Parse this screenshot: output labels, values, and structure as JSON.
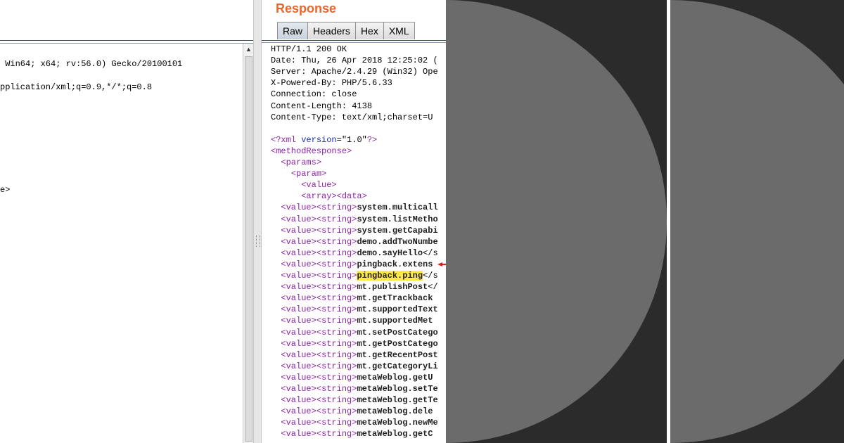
{
  "request": {
    "lines": [
      " Win64; x64; rv:56.0) Gecko/20100101",
      "",
      "pplication/xml;q=0.9,*/*;q=0.8",
      "",
      "",
      "",
      "",
      "",
      "",
      "",
      "",
      "e>"
    ]
  },
  "response": {
    "title": "Response",
    "tabs": [
      {
        "label": "Raw",
        "active": true
      },
      {
        "label": "Headers",
        "active": false
      },
      {
        "label": "Hex",
        "active": false
      },
      {
        "label": "XML",
        "active": false
      }
    ],
    "headers": [
      "HTTP/1.1 200 OK",
      "Date: Thu, 26 Apr 2018 12:25:02 (",
      "Server: Apache/2.4.29 (Win32) Ope",
      "X-Powered-By: PHP/5.6.33",
      "Connection: close",
      "Content-Length: 4138",
      "Content-Type: text/xml;charset=U"
    ],
    "xml_decl": {
      "open": "<?xml ",
      "attr": "version",
      "eq": "=\"1.0\"",
      "close": "?>"
    },
    "structure": [
      {
        "indent": "",
        "text": "<methodResponse>"
      },
      {
        "indent": "  ",
        "text": "<params>"
      },
      {
        "indent": "    ",
        "text": "<param>"
      },
      {
        "indent": "      ",
        "text": "<value>"
      },
      {
        "indent": "      ",
        "text": "<array><data>"
      }
    ],
    "value_open": "<value><string>",
    "methods": [
      {
        "name": "system.multicall",
        "tail": "",
        "highlight": false
      },
      {
        "name": "system.listMetho",
        "tail": "",
        "highlight": false
      },
      {
        "name": "system.getCapabi",
        "tail": "",
        "highlight": false
      },
      {
        "name": "demo.addTwoNumbe",
        "tail": "",
        "highlight": false
      },
      {
        "name": "demo.sayHello",
        "tail": "</s",
        "highlight": false
      },
      {
        "name": "pingback.extens",
        "tail": "",
        "highlight": false
      },
      {
        "name": "pingback.ping",
        "tail": "</s",
        "highlight": true
      },
      {
        "name": "mt.publishPost",
        "tail": "</",
        "highlight": false
      },
      {
        "name": "mt.getTrackback",
        "tail": "",
        "highlight": false
      },
      {
        "name": "mt.supportedText",
        "tail": "",
        "highlight": false
      },
      {
        "name": "mt.supportedMet",
        "tail": "",
        "highlight": false
      },
      {
        "name": "mt.setPostCatego",
        "tail": "",
        "highlight": false
      },
      {
        "name": "mt.getPostCatego",
        "tail": "",
        "highlight": false
      },
      {
        "name": "mt.getRecentPost",
        "tail": "",
        "highlight": false
      },
      {
        "name": "mt.getCategoryLi",
        "tail": "",
        "highlight": false
      },
      {
        "name": "metaWeblog.getU",
        "tail": "",
        "highlight": false
      },
      {
        "name": "metaWeblog.setTe",
        "tail": "",
        "highlight": false
      },
      {
        "name": "metaWeblog.getTe",
        "tail": "",
        "highlight": false
      },
      {
        "name": "metaWeblog.dele",
        "tail": "",
        "highlight": false
      },
      {
        "name": "metaWeblog.newMe",
        "tail": "",
        "highlight": false
      },
      {
        "name": "metaWeblog.getC",
        "tail": "",
        "highlight": false
      }
    ]
  },
  "colors": {
    "title": "#e8672e",
    "tag": "#8e23a8",
    "attribute": "#1e2ea8",
    "highlight": "#ffe84a",
    "decor_background": "#2b2b2b",
    "decor_disc": "#6b6b6b",
    "marker": "#d62020"
  },
  "icons": {
    "scroll_up": "triangle-up-icon",
    "splitter_grip": "grip-dots-icon",
    "marker": "red-arrow-icon"
  }
}
